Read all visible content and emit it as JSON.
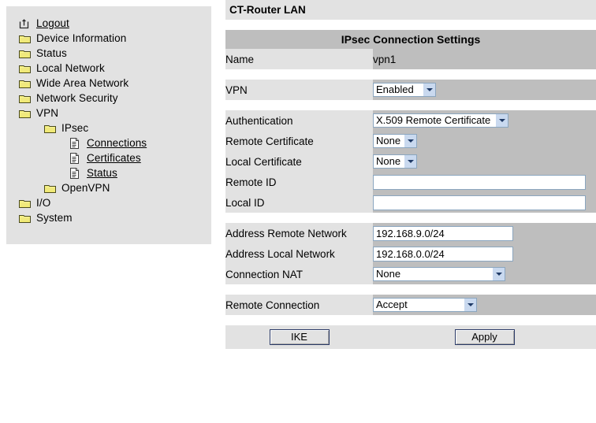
{
  "sidebar": {
    "items": [
      {
        "label": "Logout",
        "icon": "logout-icon",
        "level": 0,
        "link": true
      },
      {
        "label": "Device Information",
        "icon": "folder-icon",
        "level": 0,
        "link": false
      },
      {
        "label": "Status",
        "icon": "folder-icon",
        "level": 0,
        "link": false
      },
      {
        "label": "Local Network",
        "icon": "folder-icon",
        "level": 0,
        "link": false
      },
      {
        "label": "Wide Area Network",
        "icon": "folder-icon",
        "level": 0,
        "link": false
      },
      {
        "label": "Network Security",
        "icon": "folder-icon",
        "level": 0,
        "link": false
      },
      {
        "label": "VPN",
        "icon": "folder-icon",
        "level": 0,
        "link": false
      },
      {
        "label": "IPsec",
        "icon": "folder-icon",
        "level": 1,
        "link": false
      },
      {
        "label": "Connections",
        "icon": "document-icon",
        "level": 2,
        "link": true
      },
      {
        "label": "Certificates",
        "icon": "document-icon",
        "level": 2,
        "link": true
      },
      {
        "label": "Status",
        "icon": "document-icon",
        "level": 2,
        "link": true
      },
      {
        "label": "OpenVPN",
        "icon": "folder-icon",
        "level": 1,
        "link": false
      },
      {
        "label": "I/O",
        "icon": "folder-icon",
        "level": 0,
        "link": false
      },
      {
        "label": "System",
        "icon": "folder-icon",
        "level": 0,
        "link": false
      }
    ]
  },
  "header": {
    "title": "CT-Router LAN"
  },
  "form": {
    "section_title": "IPsec Connection Settings",
    "name_label": "Name",
    "name_value": "vpn1",
    "vpn_label": "VPN",
    "vpn_value": "Enabled",
    "auth_label": "Authentication",
    "auth_value": "X.509 Remote Certificate",
    "remote_cert_label": "Remote Certificate",
    "remote_cert_value": "None",
    "local_cert_label": "Local Certificate",
    "local_cert_value": "None",
    "remote_id_label": "Remote ID",
    "remote_id_value": "",
    "local_id_label": "Local ID",
    "local_id_value": "",
    "addr_remote_label": "Address Remote Network",
    "addr_remote_value": "192.168.9.0/24",
    "addr_local_label": "Address Local Network",
    "addr_local_value": "192.168.0.0/24",
    "conn_nat_label": "Connection NAT",
    "conn_nat_value": "None",
    "remote_conn_label": "Remote Connection",
    "remote_conn_value": "Accept",
    "ike_button": "IKE",
    "apply_button": "Apply"
  },
  "colors": {
    "panel_bg": "#e2e2e2",
    "value_bg": "#bebebe",
    "input_border": "#8ba6bf",
    "arrow_bg": "#c9d9ef",
    "button_border": "#2b3a67",
    "folder_yellow": "#f2e85c"
  }
}
